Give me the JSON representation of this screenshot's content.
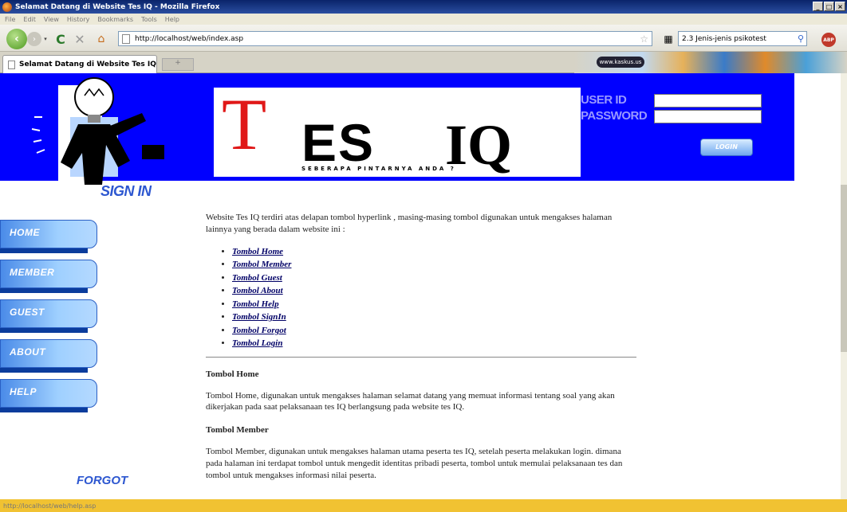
{
  "window": {
    "title": "Selamat Datang di Website Tes IQ - Mozilla Firefox",
    "menu": [
      "File",
      "Edit",
      "View",
      "History",
      "Bookmarks",
      "Tools",
      "Help"
    ]
  },
  "browser": {
    "url": "http://localhost/web/index.asp",
    "search_value": "2.3  Jenis-jenis psikotest",
    "tab_title": "Selamat Datang di Website Tes IQ",
    "kaskus": "www.kaskus.us",
    "abp": "ABP"
  },
  "header": {
    "logo_t": "T",
    "logo_es": "ES",
    "logo_iq": "IQ",
    "logo_sub": "SEBERAPA PINTARNYA ANDA ?",
    "userid_label": "USER ID",
    "password_label": "PASSWORD",
    "login_label": "LOGIN"
  },
  "sidebar": {
    "signin": "SIGN IN",
    "items": [
      {
        "label": "HOME"
      },
      {
        "label": "MEMBER"
      },
      {
        "label": "GUEST"
      },
      {
        "label": "ABOUT"
      },
      {
        "label": "HELP"
      }
    ],
    "forgot": "FORGOT"
  },
  "content": {
    "intro": "Website Tes IQ terdiri atas delapan tombol hyperlink , masing-masing tombol digunakan untuk mengakses halaman lainnya yang berada dalam website ini :",
    "links": [
      "Tombol Home",
      "Tombol Member",
      "Tombol Guest",
      "Tombol About",
      "Tombol Help",
      "Tombol SignIn",
      "Tombol Forgot",
      "Tombol Login"
    ],
    "sections": [
      {
        "heading": "Tombol Home",
        "body": "Tombol Home, digunakan untuk mengakses halaman selamat datang yang memuat informasi tentang soal yang akan dikerjakan pada saat pelaksanaan tes IQ berlangsung pada website tes IQ."
      },
      {
        "heading": "Tombol Member",
        "body": "Tombol Member, digunakan untuk mengakses halaman utama peserta tes IQ, setelah peserta melakukan login. dimana pada halaman ini terdapat tombol untuk mengedit identitas pribadi peserta, tombol untuk memulai pelaksanaan tes dan tombol untuk mengakses informasi nilai peserta."
      }
    ]
  },
  "status": {
    "text": "http://localhost/web/help.asp"
  },
  "colors": {
    "header_blue": "#0000ff",
    "logo_red": "#e01818",
    "nav_blue": "#4a8be8",
    "link_navy": "#000066",
    "statusbar_yellow": "#f1c232"
  }
}
